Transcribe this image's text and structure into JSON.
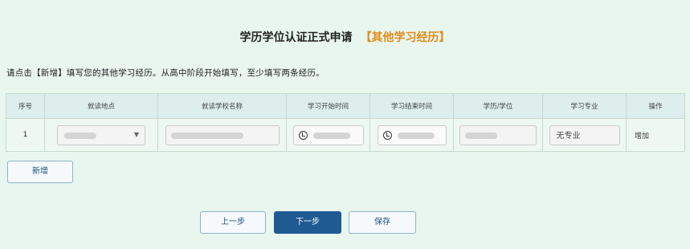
{
  "page": {
    "title": "学历学位认证正式申请",
    "subtitle": "【其他学习经历】",
    "instruction": "请点击【新增】填写您的其他学习经历。从高中阶段开始填写，至少填写两条经历。"
  },
  "table": {
    "headers": [
      "序号",
      "就读地点",
      "就读学校名称",
      "学习开始时间",
      "学习结束时间",
      "学历/学位",
      "学习专业",
      "操作"
    ],
    "rows": [
      {
        "index": "1",
        "location": "",
        "school": "",
        "start": "",
        "end": "",
        "degree": "",
        "major": "无专业",
        "action": "增加"
      }
    ]
  },
  "buttons": {
    "add": "新增",
    "prev": "上一步",
    "next": "下一步",
    "save": "保存"
  }
}
